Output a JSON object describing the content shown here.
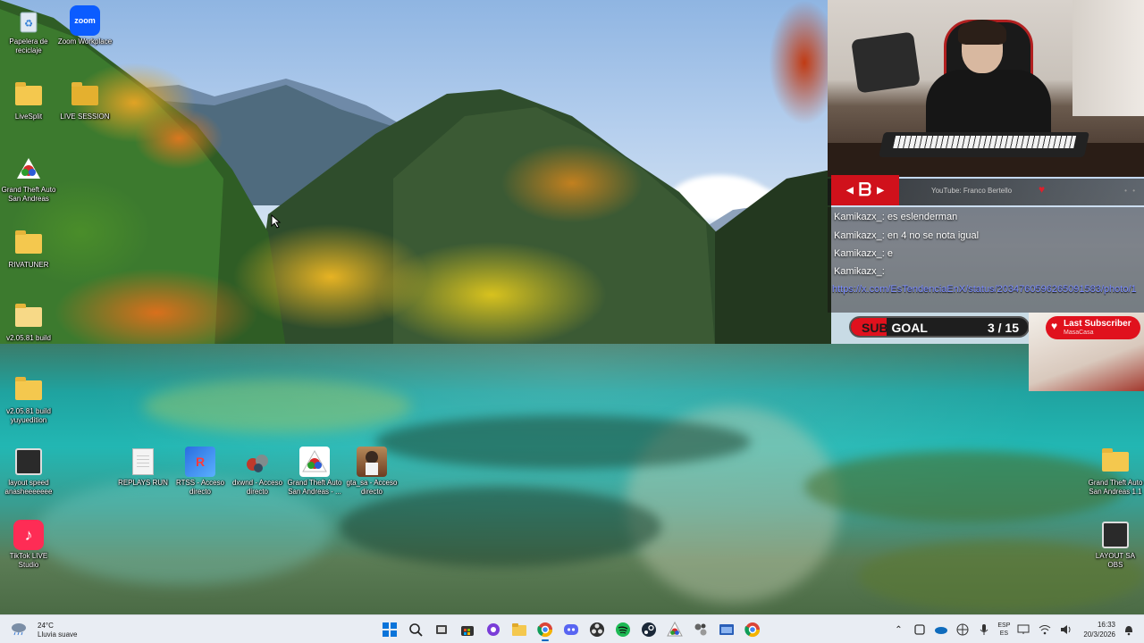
{
  "desktop": {
    "icons": [
      {
        "label": "Papelera de reciclaje",
        "icon": "recycle-bin-icon"
      },
      {
        "label": "Zoom Workplace",
        "icon": "zoom-icon"
      },
      {
        "label": "LiveSplit",
        "icon": "folder-icon"
      },
      {
        "label": "LIVE SESSION",
        "icon": "livesplit-icon"
      },
      {
        "label": "Grand Theft Auto San Andreas",
        "icon": "gta-launcher-icon"
      },
      {
        "label": "RIVATUNER",
        "icon": "folder-icon"
      },
      {
        "label": "v2.05.81 build",
        "icon": "folder-icon"
      },
      {
        "label": "v2.05.81 build yuyuedition",
        "icon": "folder-icon"
      },
      {
        "label": "layout speed anasheeeeeee",
        "icon": "monitor-icon"
      },
      {
        "label": "REPLAYS RUN",
        "icon": "document-icon"
      },
      {
        "label": "RTSS - Acceso directo",
        "icon": "rtss-icon"
      },
      {
        "label": "dxwnd - Acceso directo",
        "icon": "dxwnd-icon"
      },
      {
        "label": "Grand Theft Auto San Andreas - ...",
        "icon": "gta-launcher-icon"
      },
      {
        "label": "gta_sa - Acceso directo",
        "icon": "gta-sa-icon"
      },
      {
        "label": "TikTok LIVE Studio",
        "icon": "tiktok-icon"
      },
      {
        "label": "Grand Theft Auto San Andreas 1.1",
        "icon": "folder-icon"
      },
      {
        "label": "LAYOUT SA OBS",
        "icon": "monitor-icon"
      }
    ]
  },
  "overlay": {
    "social": {
      "youtube_text": "YouTube: Franco Bertello"
    },
    "chat": [
      {
        "user": "Kamikazx_",
        "text": "es eslenderman"
      },
      {
        "user": "Kamikazx_",
        "text": "en 4 no se nota igual"
      },
      {
        "user": "Kamikazx_",
        "text": "e"
      },
      {
        "user": "Kamikazx_",
        "text": ""
      }
    ],
    "chat_link": "https://x.com/EsTendenciaEnX/status/2034760596265091583/photo/1",
    "subgoal": {
      "label_a": "SUB",
      "label_b": " GOAL",
      "count": "3 / 15",
      "current": 3,
      "target": 15
    },
    "last_subscriber": {
      "title": "Last Subscriber",
      "name": "MasaCasa"
    }
  },
  "taskbar": {
    "weather": {
      "temp": "24°C",
      "condition": "Lluvia suave"
    },
    "apps": [
      {
        "name": "start-icon",
        "active": false
      },
      {
        "name": "search-icon",
        "active": false
      },
      {
        "name": "task-view-icon",
        "active": false
      },
      {
        "name": "store-icon",
        "active": false
      },
      {
        "name": "obs-circle-icon",
        "active": false
      },
      {
        "name": "file-explorer-icon",
        "active": false
      },
      {
        "name": "chrome-icon",
        "active": true
      },
      {
        "name": "discord-icon",
        "active": false
      },
      {
        "name": "obs-icon",
        "active": false
      },
      {
        "name": "spotify-icon",
        "active": false
      },
      {
        "name": "steam-icon",
        "active": false
      },
      {
        "name": "gta-launcher-icon",
        "active": false
      },
      {
        "name": "tools-icon",
        "active": false
      },
      {
        "name": "window-icon",
        "active": false
      },
      {
        "name": "chrome-icon-2",
        "active": false
      }
    ],
    "language": {
      "line1": "ESP",
      "line2": "ES"
    },
    "clock": {
      "time": "16:33",
      "date": "20/3/2026"
    }
  },
  "colors": {
    "accent_red": "#e0111d",
    "chat_link": "#7b8cff",
    "taskbar_bg": "#e9edf3"
  }
}
